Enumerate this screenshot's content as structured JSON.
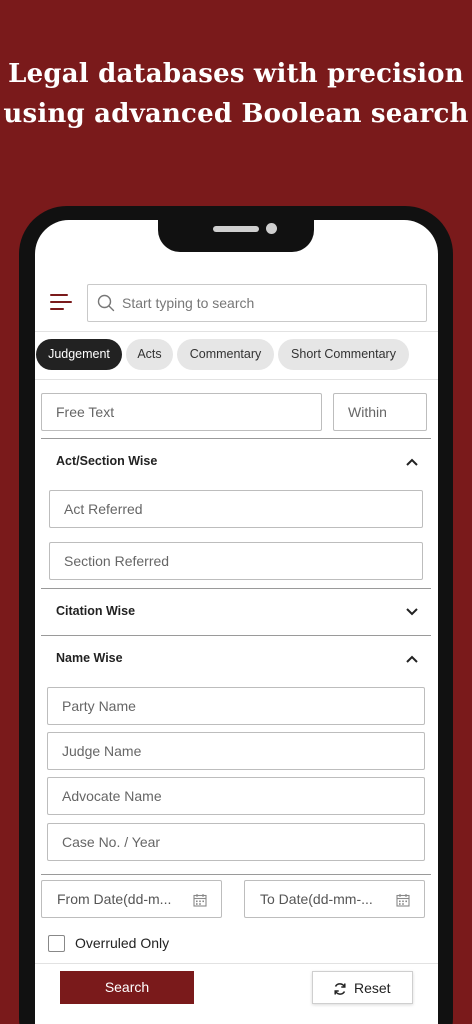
{
  "headline": {
    "line1": "Legal databases with precision",
    "line2": "using advanced Boolean search"
  },
  "header": {
    "menu_icon": "hamburger-menu-icon",
    "search_placeholder": "Start typing to search",
    "search_icon": "search-icon"
  },
  "tabs": [
    {
      "label": "Judgement",
      "active": true
    },
    {
      "label": "Acts",
      "active": false
    },
    {
      "label": "Commentary",
      "active": false
    },
    {
      "label": "Short Commentary",
      "active": false
    }
  ],
  "free_text": {
    "placeholder": "Free Text",
    "within_placeholder": "Within"
  },
  "sections": {
    "act_section": {
      "title": "Act/Section Wise",
      "expanded": true,
      "fields": [
        "Act Referred",
        "Section Referred"
      ]
    },
    "citation": {
      "title": "Citation Wise",
      "expanded": false
    },
    "name": {
      "title": "Name Wise",
      "expanded": true,
      "fields": [
        "Party Name",
        "Judge Name",
        "Advocate Name",
        "Case No. / Year"
      ]
    }
  },
  "dates": {
    "from": "From Date(dd-m...",
    "to": "To Date(dd-mm-..."
  },
  "overruled": {
    "label": "Overruled Only",
    "checked": false
  },
  "actions": {
    "search": "Search",
    "reset": "Reset"
  },
  "colors": {
    "brand": "#7a1a1b",
    "active_tab": "#222222",
    "tab_bg": "#e6e6e6"
  }
}
